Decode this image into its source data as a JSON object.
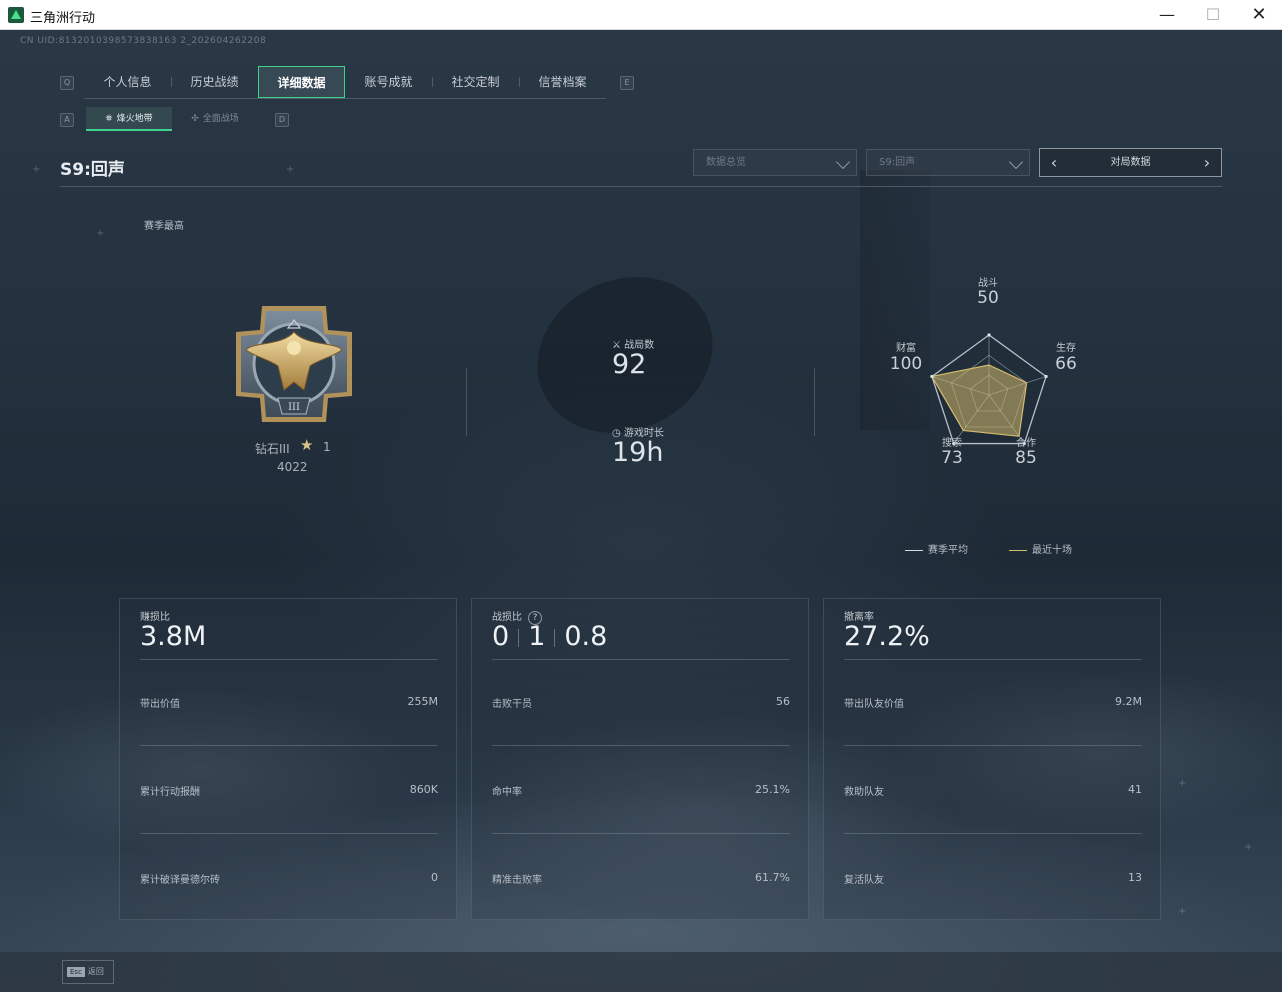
{
  "window": {
    "title": "三角洲行动",
    "min": "—",
    "max": "☐",
    "close": "✕"
  },
  "uid": "CN UID:8132010398573838163 2_202604262208",
  "tabs": {
    "key_left": "Q",
    "key_right": "E",
    "items": [
      {
        "label": "个人信息"
      },
      {
        "label": "历史战绩"
      },
      {
        "label": "详细数据"
      },
      {
        "label": "账号成就"
      },
      {
        "label": "社交定制"
      },
      {
        "label": "信誉档案"
      }
    ],
    "active_index": 2
  },
  "subtabs": {
    "key_left": "A",
    "key_right": "D",
    "items": [
      {
        "label": "烽火地带"
      },
      {
        "label": "全面战场"
      }
    ],
    "active_index": 0
  },
  "season_title": "S9:回声",
  "filters": {
    "data_type": "数据总览",
    "season": "S9:回声",
    "pager_label": "对局数据"
  },
  "season_best": {
    "label": "赛季最高",
    "rank_name": "钻石III",
    "stars": "1",
    "score": "4022",
    "badge_numeral": "III"
  },
  "summary": {
    "matches_label": "战局数",
    "matches_value": "92",
    "playtime_label": "游戏时长",
    "playtime_value": "19h"
  },
  "radar": {
    "axes": [
      {
        "label": "战斗",
        "value": "50"
      },
      {
        "label": "生存",
        "value": "66"
      },
      {
        "label": "合作",
        "value": "85"
      },
      {
        "label": "搜索",
        "value": "73"
      },
      {
        "label": "财富",
        "value": "100"
      }
    ],
    "recent_ten_values": [
      50,
      66,
      85,
      73,
      100
    ],
    "legend": [
      {
        "label": "赛季平均",
        "color": "#d6dbe0"
      },
      {
        "label": "最近十场",
        "color": "#d4bb6e"
      }
    ]
  },
  "cards": [
    {
      "head_label": "赚损比",
      "head_value": "3.8M",
      "rows": [
        {
          "label": "带出价值",
          "value": "255M"
        },
        {
          "label": "累计行动报酬",
          "value": "860K"
        },
        {
          "label": "累计破译曼德尔砖",
          "value": "0"
        }
      ]
    },
    {
      "head_label": "战损比",
      "kd": {
        "a": "0",
        "b": "1",
        "c": "0.8"
      },
      "rows": [
        {
          "label": "击败干员",
          "value": "56"
        },
        {
          "label": "命中率",
          "value": "25.1%"
        },
        {
          "label": "精准击败率",
          "value": "61.7%"
        }
      ]
    },
    {
      "head_label": "撤离率",
      "head_value": "27.2%",
      "rows": [
        {
          "label": "带出队友价值",
          "value": "9.2M"
        },
        {
          "label": "救助队友",
          "value": "41"
        },
        {
          "label": "复活队友",
          "value": "13"
        }
      ]
    }
  ],
  "footer": {
    "esc_key": "Esc",
    "back_label": "返回"
  },
  "colors": {
    "accent": "#3fd28c",
    "gold": "#d4bb6e"
  }
}
